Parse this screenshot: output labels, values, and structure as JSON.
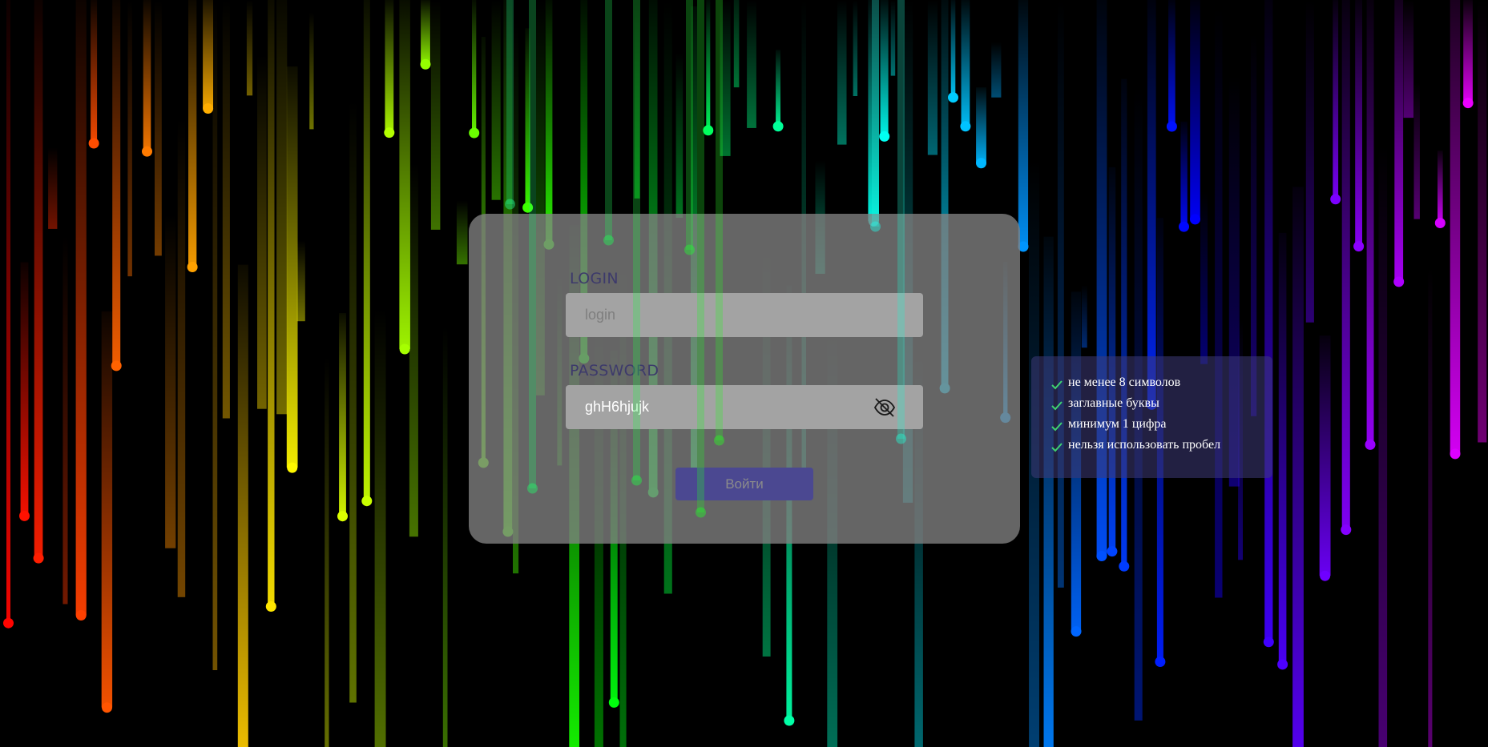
{
  "form": {
    "login_label": "LOGIN",
    "login_placeholder": "login",
    "login_value": "",
    "password_label": "PASSWORD",
    "password_value": "ghH6hjujk",
    "password_toggle_icon": "eye-slash-icon",
    "submit_label": "Войти"
  },
  "password_rules": {
    "items": [
      {
        "text": "не менее 8 символов",
        "icon": "check-icon",
        "met": true
      },
      {
        "text": "заглавные буквы",
        "icon": "check-icon",
        "met": true
      },
      {
        "text": "минимум 1 цифра",
        "icon": "check-icon",
        "met": true
      },
      {
        "text": "нельзя использовать пробел",
        "icon": "check-icon",
        "met": true
      }
    ]
  },
  "colors": {
    "background": "#000000",
    "card": "#828282",
    "label_text": "#3d3a6b",
    "field_bg": "#a3a3a3",
    "button_bg": "#4b4891",
    "button_text": "#8b8b8b",
    "check": "#3fd070",
    "rules_panel_bg": "#3e3a78"
  },
  "background": {
    "style": "rainbow-rain-streaks"
  }
}
